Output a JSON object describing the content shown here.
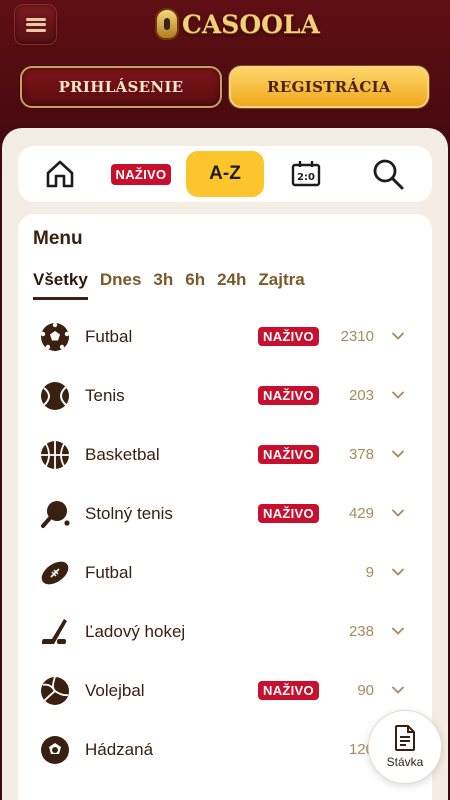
{
  "header": {
    "logo_text": "CASOOLA",
    "menu_icon": "hamburger-icon"
  },
  "auth": {
    "login_label": "PRIHLÁSENIE",
    "register_label": "REGISTRÁCIA"
  },
  "tabs": {
    "home_icon": "home-icon",
    "live_label": "NAŽIVO",
    "az_label": "A-Z",
    "scoreboard_icon": "scoreboard-icon",
    "search_icon": "search-icon"
  },
  "menu": {
    "title": "Menu",
    "filters": [
      "Všetky",
      "Dnes",
      "3h",
      "6h",
      "24h",
      "Zajtra"
    ],
    "active_filter": "Všetky",
    "sports": [
      {
        "name": "Futbal",
        "icon": "soccer-ball-icon",
        "live": "NAŽIVO",
        "count": "2310"
      },
      {
        "name": "Tenis",
        "icon": "tennis-ball-icon",
        "live": "NAŽIVO",
        "count": "203"
      },
      {
        "name": "Basketbal",
        "icon": "basketball-icon",
        "live": "NAŽIVO",
        "count": "378"
      },
      {
        "name": "Stolný tenis",
        "icon": "table-tennis-icon",
        "live": "NAŽIVO",
        "count": "429"
      },
      {
        "name": "Futbal",
        "icon": "american-football-icon",
        "live": "",
        "count": "9"
      },
      {
        "name": "Ľadový hokej",
        "icon": "ice-hockey-icon",
        "live": "",
        "count": "238"
      },
      {
        "name": "Volejbal",
        "icon": "volleyball-icon",
        "live": "NAŽIVO",
        "count": "90"
      },
      {
        "name": "Hádzaná",
        "icon": "handball-icon",
        "live": "",
        "count": "120"
      }
    ]
  },
  "betslip": {
    "label": "Stávka",
    "icon": "document-icon"
  },
  "colors": {
    "header_bg": "#5e0f14",
    "gold": "#f0a81d",
    "live_red": "#c8102e",
    "az_yellow": "#fdc52c",
    "text_brown": "#3a2010"
  }
}
